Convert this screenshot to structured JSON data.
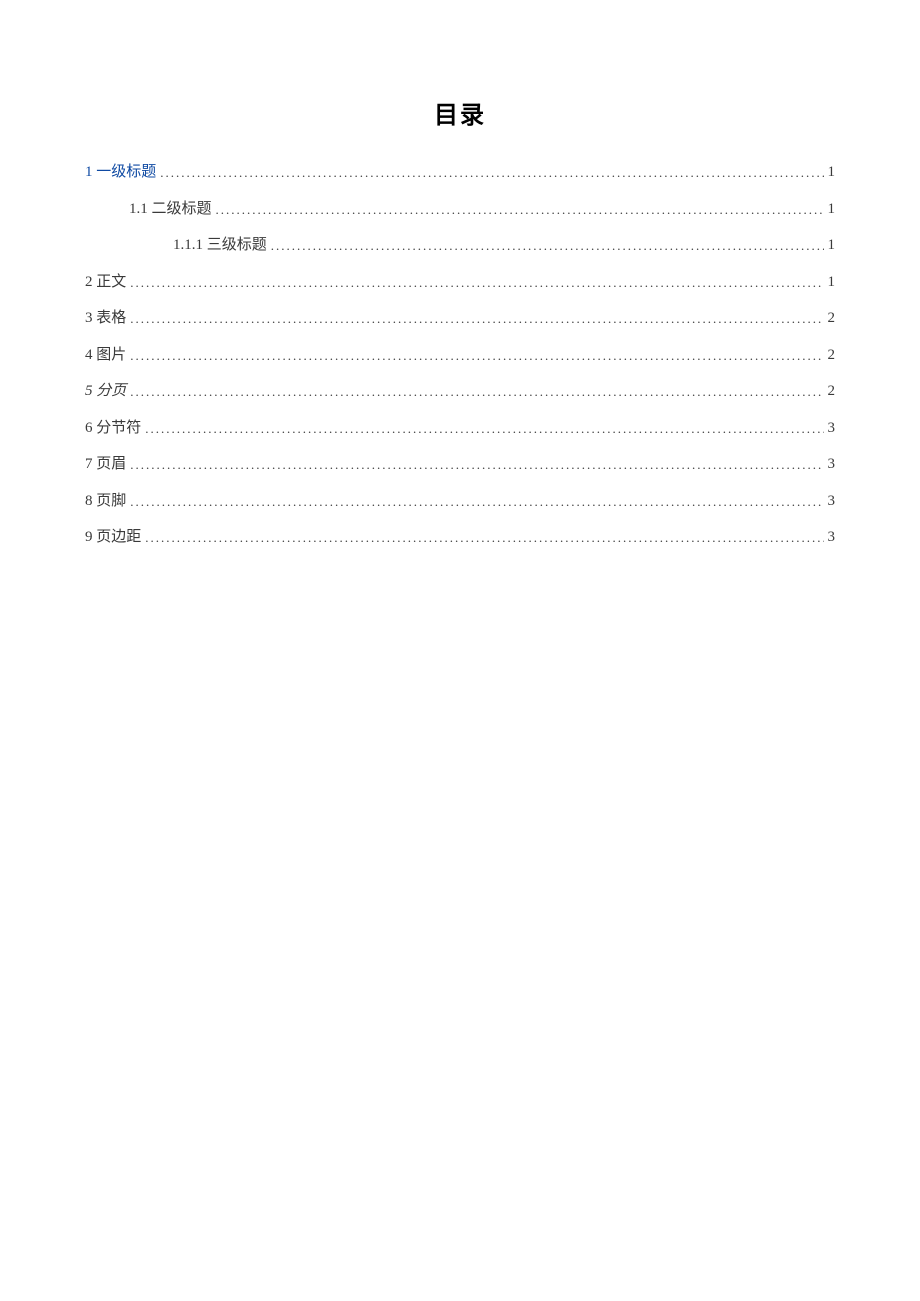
{
  "title": "目录",
  "entries": [
    {
      "label": "1  一级标题",
      "page": "1",
      "indent": 0,
      "link": true
    },
    {
      "label": "1.1  二级标题",
      "page": "1",
      "indent": 1
    },
    {
      "label": "1.1.1  三级标题",
      "page": "1",
      "indent": 2
    },
    {
      "label": "2 正文",
      "page": "1",
      "indent": 0
    },
    {
      "label": "3 表格",
      "page": "2",
      "indent": 0
    },
    {
      "label": "4 图片",
      "page": "2",
      "indent": 0
    },
    {
      "label": "5 分页",
      "page": "2",
      "indent": 0,
      "italic_num": true
    },
    {
      "label": "6 分节符",
      "page": "3",
      "indent": 0
    },
    {
      "label": "7 页眉",
      "page": "3",
      "indent": 0
    },
    {
      "label": "8 页脚",
      "page": "3",
      "indent": 0
    },
    {
      "label": "9 页边距",
      "page": "3",
      "indent": 0
    }
  ]
}
